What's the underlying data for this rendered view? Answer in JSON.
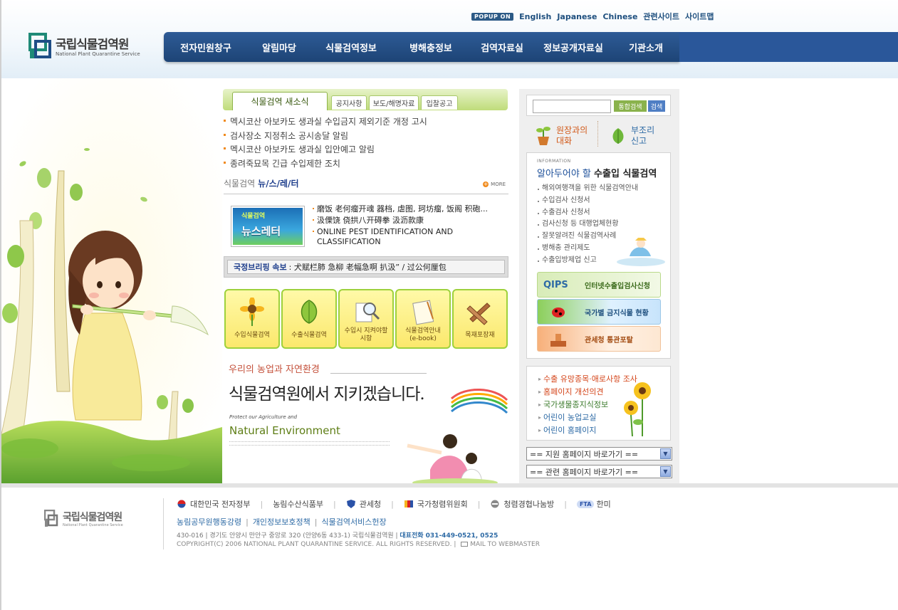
{
  "top_nav": {
    "popup": "POPUP ON",
    "items": [
      "English",
      "Japanese",
      "Chinese",
      "관련사이트",
      "사이트맵"
    ]
  },
  "logo": {
    "korean": "국립식물검역원",
    "english": "National Plant Quarantine Service"
  },
  "main_menu": [
    "전자민원창구",
    "알림마당",
    "식물검역정보",
    "병해충정보",
    "검역자료실",
    "정보공개자료실",
    "기관소개"
  ],
  "notice": {
    "tabs": [
      "식물검역 새소식",
      "공지사항",
      "보도/해명자료",
      "입찰공고"
    ],
    "items": [
      "멕시코산 아보카도 생과실 수입금지 제외기준 개정 고시",
      "검사장소 지정취소 공시송달 알림",
      "멕시코산 아보카도 생과실 입안예고 알림",
      "종려죽묘목 긴급 수입제한 조치"
    ]
  },
  "newsletter": {
    "title_prefix": "식물검역",
    "title_main": "뉴/스/레/터",
    "more": "MORE",
    "thumb_small": "식물검역",
    "thumb_large": "뉴스레터",
    "items": [
      "磨饭 老何瘤开魂 器档, 虐图, 珂坊瘤, 饭阁 积砲...",
      "汲傈饶 侥拱八开碍拳 汲沥款康",
      "ONLINE PEST IDENTIFICATION AND CLASSIFICATION"
    ]
  },
  "briefing": {
    "label": "국정브리핑 속보",
    "text": ": 犬赋栏肺 急柳 老幅急啊 扒汲”  / 过公何厘包"
  },
  "quick_menu": [
    {
      "label": "수입식물검역",
      "icon": "sunflower-icon"
    },
    {
      "label": "수출식물검역",
      "icon": "leaf-icon"
    },
    {
      "label": "수입시 지켜야할\n시항",
      "icon": "magnifier-icon"
    },
    {
      "label": "식물검역안내\n(e-book)",
      "icon": "clipboard-icon"
    },
    {
      "label": "목재포장재",
      "icon": "wood-pallet-icon"
    }
  ],
  "slogan": {
    "line1": "우리의 농업과 자연환경",
    "line2": "식물검역원에서 지키겠습니다.",
    "line3": "Protect our Agriculture and",
    "line4": "Natural Environment"
  },
  "search": {
    "placeholder": "",
    "integrated_label": "통합검색",
    "search_label": "검색"
  },
  "talk": {
    "director": "원장과의\n대화",
    "report": "부조리\n신고"
  },
  "info": {
    "caption": "INFORMATION",
    "title_light": "알아두어야 할",
    "title_bold": "수출입 식물검역",
    "items": [
      "해외여행객을 위한 식물검역안내",
      "수입검사 신청서",
      "수출검사 신청서",
      "검사신청 등 대행업체현황",
      "잘못알려진 식물검역사례",
      "병해충 관리제도",
      "수출입방제업 신고"
    ],
    "banners": [
      "인터넷수출입검사신청",
      "국가별 금지식물 현황",
      "관세청 통관포탈"
    ],
    "banner_brand": "QIPS"
  },
  "links": {
    "items": [
      "수출 유망종목·애로사항 조사",
      "홈페이지 개선의견",
      "국가생물종지식정보",
      "어린이 농업교실",
      "어린이 홈페이지"
    ],
    "colors": [
      "#d4451a",
      "#d4451a",
      "#3a7a2a",
      "#2d6aa5",
      "#2d6aa5"
    ]
  },
  "selects": {
    "branch": "== 지원 홈페이지 바로가기 ==",
    "related": "== 관련 홈페이지 바로가기 =="
  },
  "footer": {
    "logo_korean": "국립식물검역원",
    "logo_english": "National Plant Quarantine Service",
    "partners": [
      "대한민국 전자정부",
      "농림수산식품부",
      "관세청",
      "국가청렴위원회",
      "청렴경협나눔방",
      "한미"
    ],
    "fta": "FTA",
    "links": [
      "농림공무원행동강령",
      "개인정보보호정책",
      "식물검역서비스헌장"
    ],
    "address": "430-016  |  경기도 안양시 만안구 중앙로 320 (안양6동 433-1) 국립식물검역원  |",
    "tel": "대표전화 031-449-0521, 0525",
    "copyright": "COPYRIGHT(C) 2006 NATIONAL PLANT QUARANTINE SERVICE. ALL RIGHTS RESERVED.  |",
    "webmaster": "MAIL TO WEBMASTER"
  }
}
